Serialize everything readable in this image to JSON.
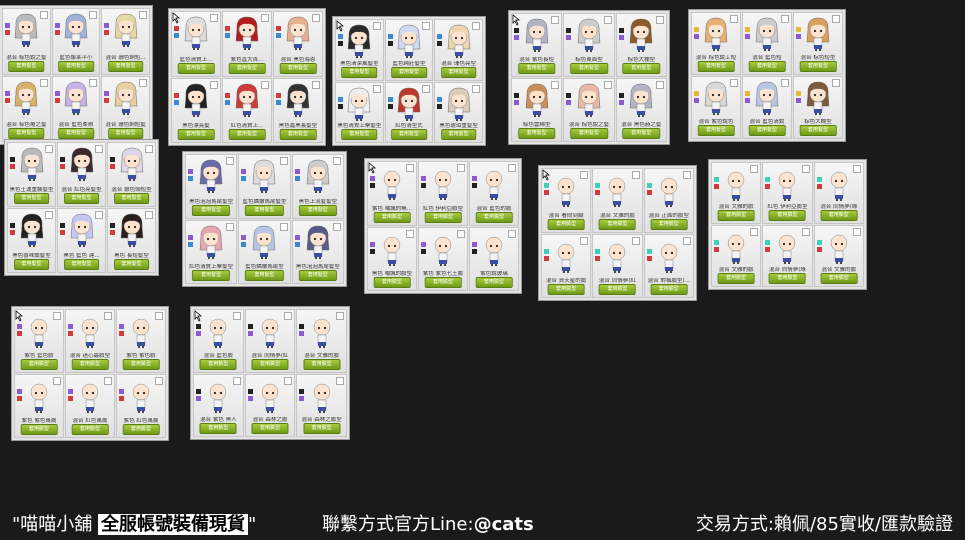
{
  "panels": [
    {
      "labels": [
        "混合 棕色銳之髮",
        "藍色像某平小",
        "混合 珊色銅短...",
        "混合 棕色捲之髮",
        "混合 藍色柔剛",
        "混合 珊色銅短髮"
      ],
      "button": "套用髮型",
      "hair": [
        "#bbbbbb",
        "#9fb3d9",
        "#e6d7a6",
        "#d9b06a",
        "#c6b3e6",
        "#e6cfa0"
      ],
      "sw": [
        "#8a5bd1",
        "#d43b3b"
      ]
    },
    {
      "labels": [
        "藍色清質上...",
        "紫色直大首...",
        "混合 黑色海恩",
        "黑色漂亮髮",
        "紅色清質上...",
        "黑色嘉黑長髮型"
      ],
      "button": "套用髮型",
      "hair": [
        "#dddddd",
        "#b41d1d",
        "#e6b090",
        "#222222",
        "#cc3a3a",
        "#333333"
      ],
      "sw": [
        "#d13b3b",
        "#3b8ad1"
      ]
    },
    {
      "labels": [
        "黑色清潔風髮型",
        "藍色純莊髮型",
        "混合 珊色亮型",
        "黑色清質上擊髮型",
        "紅色清型式",
        "黑色琥珀重髮型"
      ],
      "button": "套用髮型",
      "hair": [
        "#2a2a2a",
        "#cfd9f2",
        "#f0d6b0",
        "#eeeeee",
        "#b93a2a",
        "#d9ccb8"
      ],
      "sw": [
        "#3b8ad1",
        "#222222"
      ]
    },
    {
      "labels": [
        "混合 紫色長短",
        "棕色東面型",
        "棕色大棚型",
        "棕色雲梯型",
        "混合 棕色銳之髮",
        "混合 黑色赫之髮"
      ],
      "button": "套用髮型",
      "hair": [
        "#b3b3c6",
        "#cccccc",
        "#8a5a2a",
        "#c98e5a",
        "#e6b8a6",
        "#b3b3c6"
      ],
      "sw": [
        "#222222",
        "#8a5bd1"
      ]
    },
    {
      "labels": [
        "混合 棕色銳工短",
        "混合 藍色短",
        "混合 棕色短型",
        "混合 紫色銳色",
        "混合 藍色清銳",
        "棕色大棚型"
      ],
      "button": "套用髮型",
      "hair": [
        "#e6b070",
        "#cccccc",
        "#d9a05a",
        "#d9d9d9",
        "#b8c6e6",
        "#7a5a3a"
      ],
      "sw": [
        "#e6b83b",
        "#8a5bd1"
      ]
    },
    {
      "labels": [
        "黑色王運重裝髮型",
        "混合 紅色亮髮型",
        "混合 銀色頭短型",
        "黑色香味蘭髮型",
        "黑色 藍色 達...",
        "黑色 長短髮型"
      ],
      "button": "套用髮型",
      "hair": [
        "#bbbbbb",
        "#3a2a2a",
        "#ddd6e6",
        "#222222",
        "#c6c6f2",
        "#2a2020"
      ],
      "sw": [
        "#222222",
        "#d13b3b"
      ]
    },
    {
      "labels": [
        "黑色泡泡馬尾髮型",
        "藍色嬌嫩馬尾髮型",
        "黑色上流髮髮型",
        "紅色清質上擊髮型",
        "藍色嬌嫩馬尾型",
        "黑色泡泡馬尾髮型"
      ],
      "button": "套用髮型",
      "hair": [
        "#6a6aa6",
        "#dddddd",
        "#cccccc",
        "#e6a6b0",
        "#b8c6e6",
        "#5a5a8a"
      ],
      "sw": [
        "#8a5bd1",
        "#3b8ad1"
      ]
    },
    {
      "labels": [
        "紫色 嘲諷的無...",
        "紅色 伊利亞臉型",
        "混合 藍色的臉",
        "黑色 嘲諷的臉型",
        "紫色 紫色七王臉",
        "紫色銳玻璃"
      ],
      "button": "套用臉型",
      "hair": [
        "#f2f2f2",
        "#f2f2f2",
        "#f2f2f2",
        "#f2f2f2",
        "#f2f2f2",
        "#f2f2f2"
      ],
      "sw": [
        "#8a5bd1",
        "#222222"
      ]
    },
    {
      "labels": [
        "混合 看向到腳",
        "混合 文雅的臉",
        "混合 正面的臉型",
        "混合 資天星的臉",
        "混合 同情夢(紅",
        "混合 對稱臉型(..."
      ],
      "button": "套用臉型",
      "hair": [
        "#f2f2f2",
        "#f2f2f2",
        "#f2f2f2",
        "#f2f2f2",
        "#f2f2f2",
        "#f2f2f2"
      ],
      "sw": [
        "#3bd1b8",
        "#d13b3b"
      ]
    },
    {
      "labels": [
        "混合 文雅的臉",
        "紅色 伊利亞臉型",
        "混合 同情夢(綠",
        "混合 文雅的臉",
        "混合 同情夢(綠",
        "混合 文雅的臉"
      ],
      "button": "套用臉型",
      "hair": [
        "#f2f2f2",
        "#f2f2f2",
        "#f2f2f2",
        "#f2f2f2",
        "#f2f2f2",
        "#f2f2f2"
      ],
      "sw": [
        "#3bd1b8",
        "#d13b3b"
      ]
    },
    {
      "labels": [
        "紫色 藍色臉",
        "混合 迷心最臉型",
        "紫色 紫色臉",
        "紫色 紫色萬歲",
        "混合 紅色萬歲",
        "紫色 紅色萬歲"
      ],
      "button": "套用臉型",
      "hair": [
        "#f2f2f2",
        "#f2f2f2",
        "#f2f2f2",
        "#f2f2f2",
        "#f2f2f2",
        "#f2f2f2"
      ],
      "sw": [
        "#8a5bd1",
        "#d13b3b"
      ]
    },
    {
      "labels": [
        "混合 藍色臉",
        "混合 同情夢(紅",
        "混合 文雅的臉",
        "混合 紫色 黑人",
        "混合 森林之臉",
        "混合 森林之臉型"
      ],
      "button": "套用臉型",
      "hair": [
        "#f2f2f2",
        "#f2f2f2",
        "#f2f2f2",
        "#f2f2f2",
        "#f2f2f2",
        "#f2f2f2"
      ],
      "sw": [
        "#222222",
        "#8a5bd1"
      ]
    }
  ],
  "footer": {
    "left_prefix": "\"喵喵小舖",
    "left_highlight": "全服帳號裝備現貨",
    "left_suffix": "\"",
    "middle_prefix": "聯繫方式官方Line:",
    "middle_bold": "@cats",
    "right": "交易方式:賴佩/85實收/匯款驗證"
  }
}
